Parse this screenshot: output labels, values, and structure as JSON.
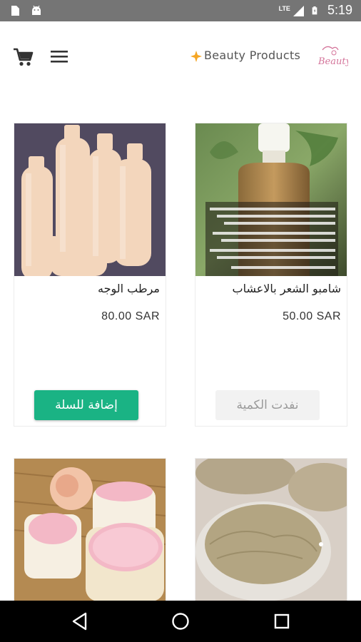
{
  "status_bar": {
    "time": "5:19",
    "network": "LTE",
    "icons": [
      "sd-card-icon",
      "android-icon",
      "signal-icon",
      "battery-icon"
    ]
  },
  "header": {
    "brand_text": "Beauty Products",
    "logo_text": "Beauty",
    "icons": [
      "cart-icon",
      "menu-icon"
    ]
  },
  "products": [
    {
      "name": "شامبو الشعر بالاعشاب",
      "price": "50.00 SAR",
      "button": "نفدت الكمية",
      "available": false,
      "image_caption": "شامبو الشعر بالاعشاب"
    },
    {
      "name": "مرطب الوجه",
      "price": "80.00 SAR",
      "button": "إضافة للسلة",
      "available": true
    },
    {
      "name": "",
      "price": ""
    },
    {
      "name": "",
      "price": ""
    }
  ],
  "colors": {
    "accent": "#1ab384",
    "status_bar": "#757575",
    "nav_bar": "#000000",
    "brand_star": "#f5a623",
    "logo_pink": "#d4749a"
  },
  "nav_bar": {
    "icons": [
      "back-icon",
      "home-icon",
      "recents-icon"
    ]
  }
}
